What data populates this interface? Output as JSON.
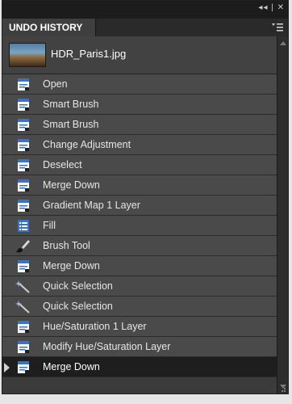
{
  "panel": {
    "title": "UNDO HISTORY",
    "document_name": "HDR_Paris1.jpg",
    "top_controls": "◂◂ | ✕"
  },
  "history": [
    {
      "label": "Open",
      "icon": "document-icon"
    },
    {
      "label": "Smart Brush",
      "icon": "document-icon"
    },
    {
      "label": "Smart Brush",
      "icon": "document-icon"
    },
    {
      "label": "Change Adjustment",
      "icon": "document-icon"
    },
    {
      "label": "Deselect",
      "icon": "document-icon"
    },
    {
      "label": "Merge Down",
      "icon": "document-icon"
    },
    {
      "label": "Gradient Map 1 Layer",
      "icon": "document-icon"
    },
    {
      "label": "Fill",
      "icon": "list-icon"
    },
    {
      "label": "Brush Tool",
      "icon": "brush-icon"
    },
    {
      "label": "Merge Down",
      "icon": "document-icon"
    },
    {
      "label": "Quick Selection",
      "icon": "wand-icon"
    },
    {
      "label": "Quick Selection",
      "icon": "wand-icon"
    },
    {
      "label": "Hue/Saturation 1 Layer",
      "icon": "document-icon"
    },
    {
      "label": "Modify Hue/Saturation Layer",
      "icon": "document-icon"
    },
    {
      "label": "Merge Down",
      "icon": "document-icon",
      "selected": true
    }
  ],
  "colors": {
    "panel_bg": "#3b3b3b",
    "row_bg": "#4a4a4a",
    "selected_row_bg": "#1e1e1e",
    "icon_blue": "#3b72c4"
  }
}
